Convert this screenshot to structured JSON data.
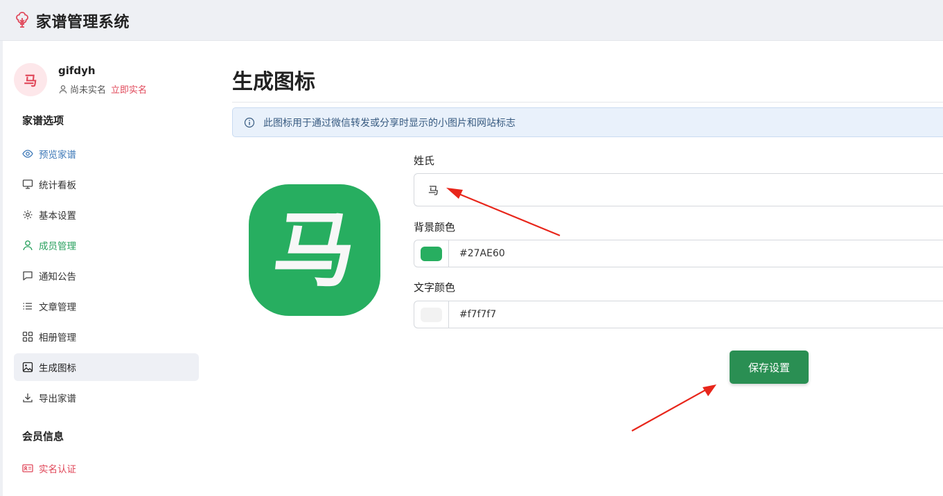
{
  "app": {
    "title": "家谱管理系统",
    "icon": "tree-icon"
  },
  "user": {
    "avatar_char": "马",
    "name": "gifdyh",
    "realname_status": "尚未实名",
    "realname_link": "立即实名"
  },
  "sidebar": {
    "group1_title": "家谱选项",
    "items": [
      {
        "label": "预览家谱",
        "icon": "eye-icon"
      },
      {
        "label": "统计看板",
        "icon": "monitor-icon"
      },
      {
        "label": "基本设置",
        "icon": "gear-icon"
      },
      {
        "label": "成员管理",
        "icon": "user-icon"
      },
      {
        "label": "通知公告",
        "icon": "message-icon"
      },
      {
        "label": "文章管理",
        "icon": "list-icon"
      },
      {
        "label": "相册管理",
        "icon": "grid-icon"
      },
      {
        "label": "生成图标",
        "icon": "image-icon"
      },
      {
        "label": "导出家谱",
        "icon": "download-icon"
      }
    ],
    "group2_title": "会员信息",
    "items2": [
      {
        "label": "实名认证",
        "icon": "id-card-icon"
      }
    ]
  },
  "main": {
    "title": "生成图标",
    "alert": "此图标用于通过微信转发或分享时显示的小图片和网站标志",
    "preview_char": "马",
    "surname_label": "姓氏",
    "surname_value": "马",
    "bg_color_label": "背景颜色",
    "bg_color_value": "#27AE60",
    "text_color_label": "文字颜色",
    "text_color_value": "#f7f7f7",
    "save_label": "保存设置"
  },
  "colors": {
    "accent_green": "#27AE60",
    "button_green": "#2a8f53",
    "link_red": "#e0485a",
    "link_blue": "#3e79b8",
    "annotation_red": "#e8261b"
  }
}
